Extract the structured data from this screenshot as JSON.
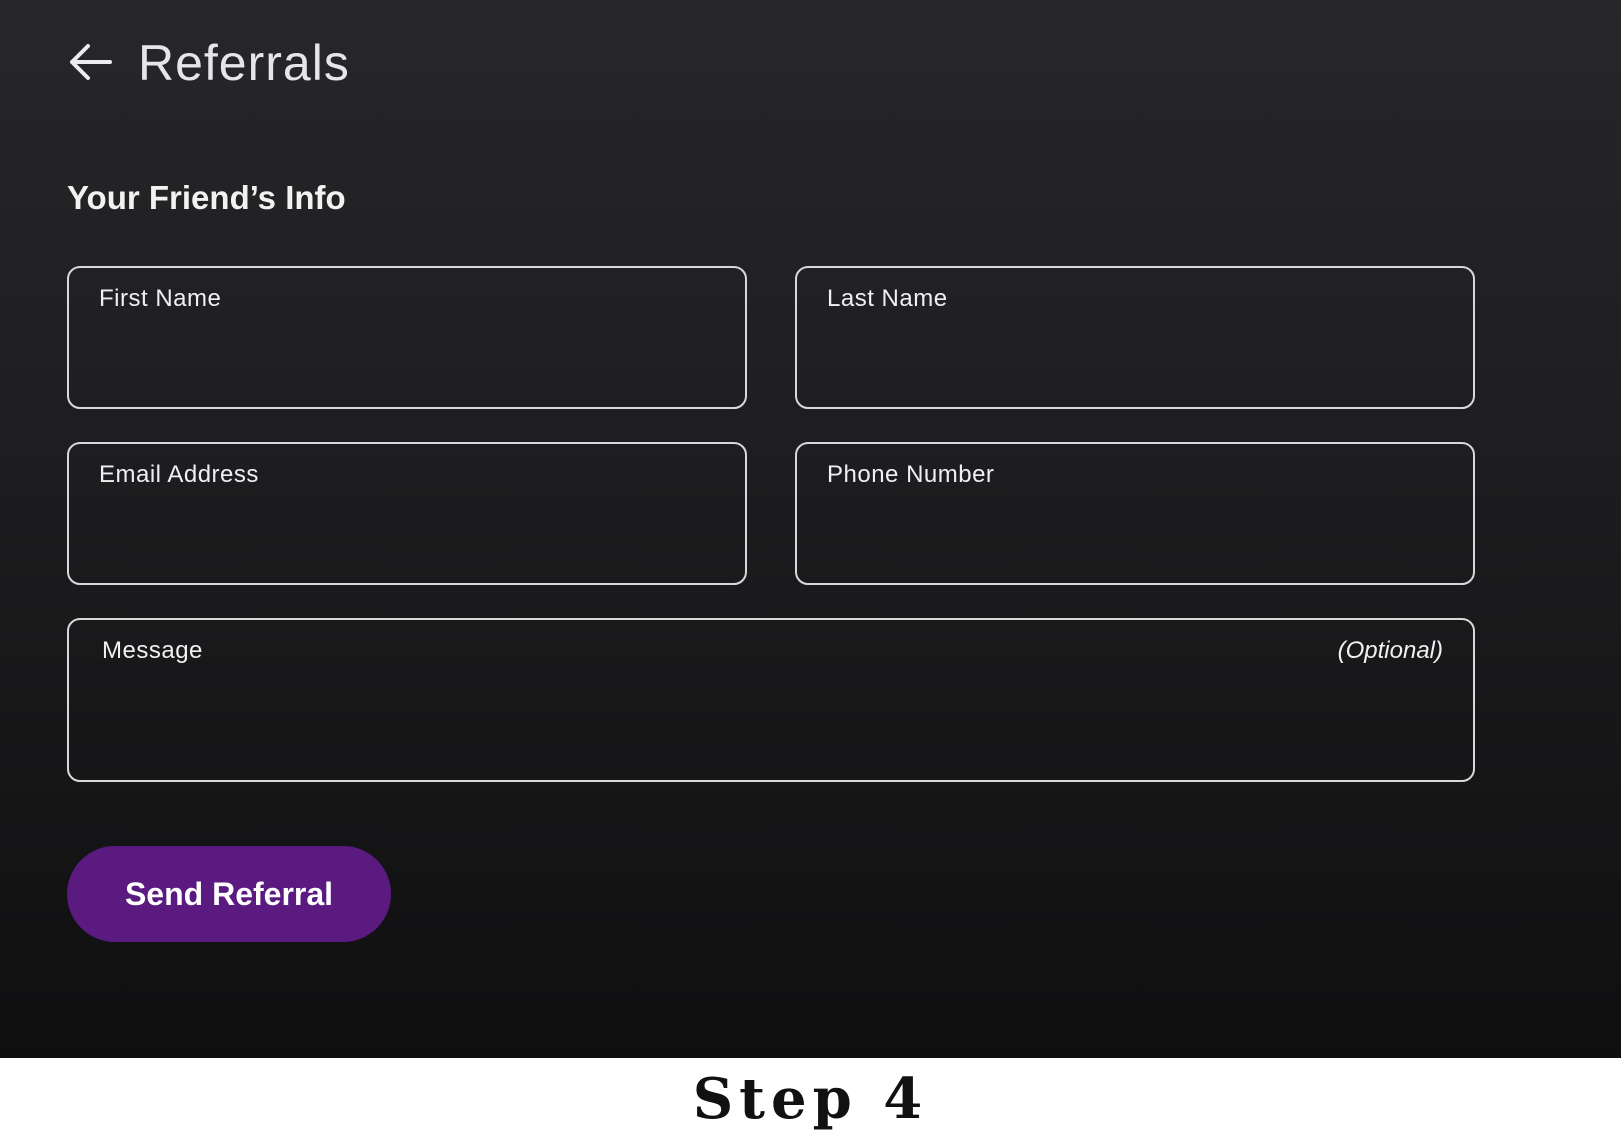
{
  "header": {
    "back_icon": "arrow-left-icon",
    "title": "Referrals"
  },
  "form": {
    "section_title": "Your Friend’s Info",
    "first_name": {
      "label": "First Name",
      "value": ""
    },
    "last_name": {
      "label": "Last Name",
      "value": ""
    },
    "email": {
      "label": "Email Address",
      "value": ""
    },
    "phone": {
      "label": "Phone Number",
      "value": ""
    },
    "message": {
      "label": "Message",
      "note": "(Optional)",
      "value": ""
    },
    "submit_label": "Send Referral"
  },
  "caption": "Step 4",
  "colors": {
    "accent": "#5a1a80",
    "background": "#1d1d1f",
    "field_border": "#d8d8dc"
  }
}
